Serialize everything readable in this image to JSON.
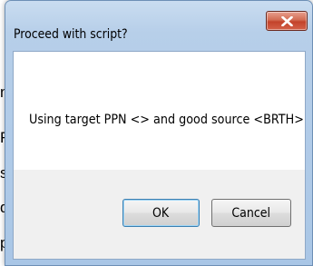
{
  "background": {
    "fragments": [
      "n",
      "Re",
      "s",
      "d",
      "p"
    ]
  },
  "dialog": {
    "title": "Proceed with script?",
    "message": "Using target PPN <> and good source <BRTH>",
    "buttons": {
      "ok_label": "OK",
      "cancel_label": "Cancel"
    },
    "close_icon": "close-icon"
  },
  "colors": {
    "title_bar": "#b7cfe9",
    "close_button": "#c3432b",
    "client_area": "#f0f0f0"
  }
}
